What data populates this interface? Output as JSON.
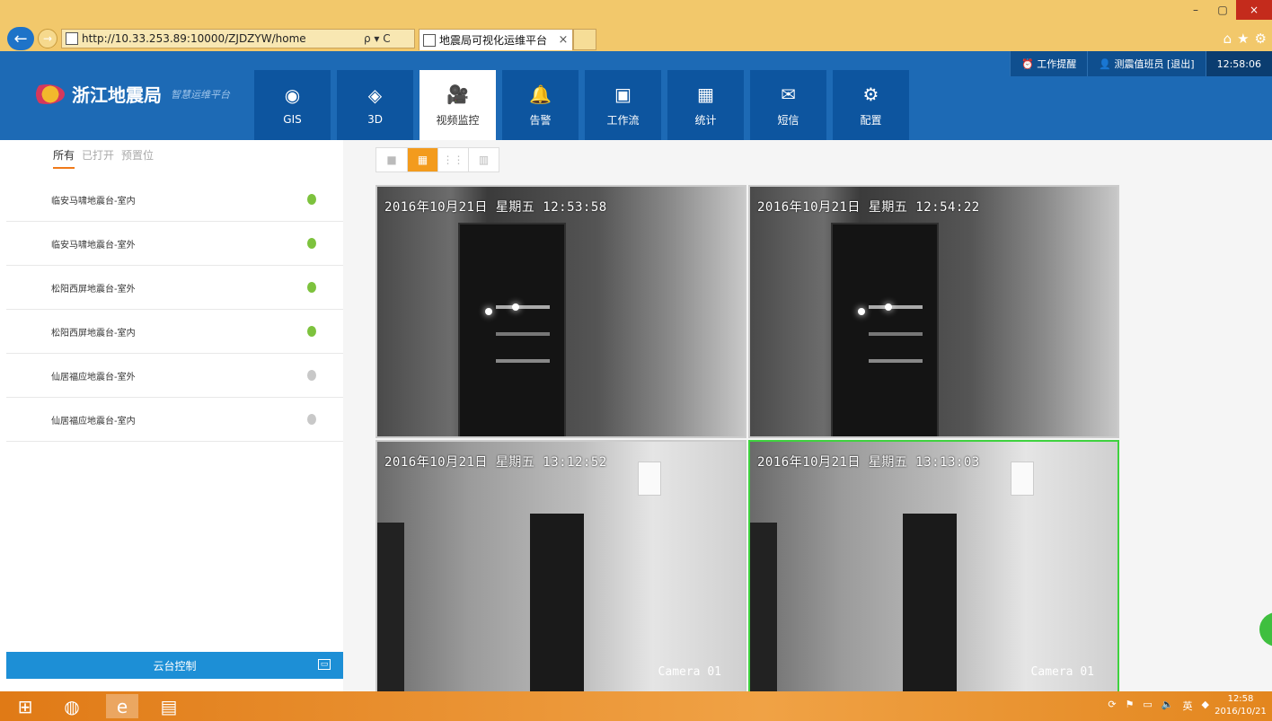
{
  "browser": {
    "url": "http://10.33.253.89:10000/ZJDZYW/home",
    "tab_title": "地震局可视化运维平台",
    "tab_close": "×",
    "addr_tools": "ρ ▾ C",
    "min": "–",
    "max": "▢",
    "close": "×"
  },
  "header": {
    "org_name": "浙江地震局",
    "slogan": "智慧运维平台",
    "work_reminder": "工作提醒",
    "user": "测震值班员",
    "logout": "[退出]",
    "time": "12:58:06"
  },
  "nav": [
    {
      "label": "GIS",
      "icon": "gis-icon"
    },
    {
      "label": "3D",
      "icon": "3d-icon"
    },
    {
      "label": "视频监控",
      "icon": "camera-icon"
    },
    {
      "label": "告警",
      "icon": "bell-icon"
    },
    {
      "label": "工作流",
      "icon": "workflow-icon"
    },
    {
      "label": "统计",
      "icon": "stats-icon"
    },
    {
      "label": "短信",
      "icon": "mail-icon"
    },
    {
      "label": "配置",
      "icon": "gear-icon"
    }
  ],
  "left": {
    "tabs": [
      "所有",
      "已打开",
      "预置位"
    ],
    "cameras": [
      {
        "name": "临安马啸地震台-室内",
        "online": true
      },
      {
        "name": "临安马啸地震台-室外",
        "online": true
      },
      {
        "name": "松阳西屏地震台-室外",
        "online": true
      },
      {
        "name": "松阳西屏地震台-室内",
        "online": true
      },
      {
        "name": "仙居福应地震台-室外",
        "online": false
      },
      {
        "name": "仙居福应地震台-室内",
        "online": false
      }
    ],
    "ptz_label": "云台控制"
  },
  "video": {
    "cells": [
      {
        "timestamp": "2016年10月21日 星期五 12:53:58",
        "camera": ""
      },
      {
        "timestamp": "2016年10月21日 星期五 12:54:22",
        "camera": ""
      },
      {
        "timestamp": "2016年10月21日 星期五 13:12:52",
        "camera": "Camera 01"
      },
      {
        "timestamp": "2016年10月21日 星期五 13:13:03",
        "camera": "Camera 01"
      }
    ]
  },
  "taskbar": {
    "clock_time": "12:58",
    "clock_date": "2016/10/21",
    "ime": "英"
  },
  "colors": {
    "header": "#1d6ab5",
    "accent": "#f07a1a",
    "taskbar": "#e98d2a"
  }
}
